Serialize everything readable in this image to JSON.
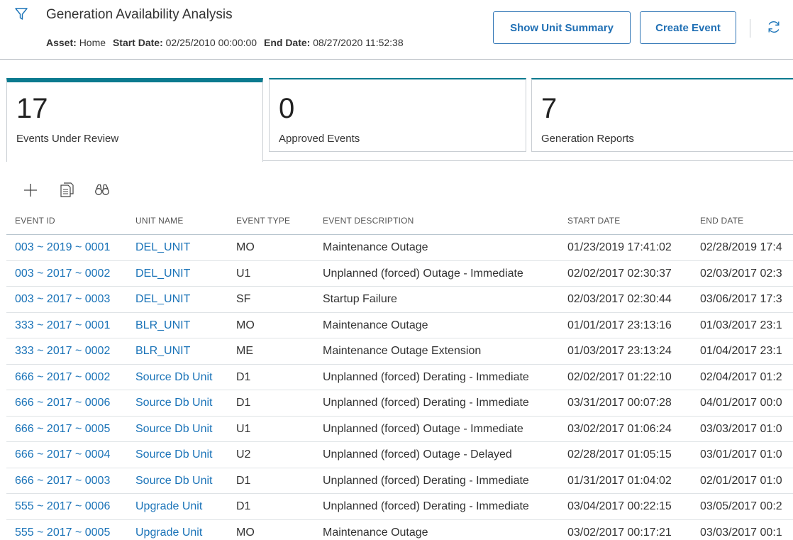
{
  "header": {
    "title": "Generation Availability Analysis",
    "asset_label": "Asset:",
    "asset_value": "Home",
    "start_label": "Start Date:",
    "start_value": "02/25/2010 00:00:00",
    "end_label": "End Date:",
    "end_value": "08/27/2020 11:52:38",
    "show_unit_summary_label": "Show Unit Summary",
    "create_event_label": "Create Event",
    "icons": [
      "filter-icon",
      "refresh-icon"
    ]
  },
  "colors": {
    "accent": "#0b7a8f",
    "link": "#1a73b8",
    "button": "#2e74b5"
  },
  "tiles": [
    {
      "count": "17",
      "label": "Events Under Review",
      "active": true
    },
    {
      "count": "0",
      "label": "Approved Events",
      "active": false
    },
    {
      "count": "7",
      "label": "Generation Reports",
      "active": false
    }
  ],
  "toolbar": {
    "icons": [
      "add-icon",
      "copy-icon",
      "binoculars-icon"
    ]
  },
  "table": {
    "columns": [
      "EVENT ID",
      "UNIT NAME",
      "EVENT TYPE",
      "EVENT DESCRIPTION",
      "START DATE",
      "END DATE"
    ],
    "rows": [
      [
        "003 ~ 2019 ~ 0001",
        "DEL_UNIT",
        "MO",
        "Maintenance Outage",
        "01/23/2019 17:41:02",
        "02/28/2019 17:4"
      ],
      [
        "003 ~ 2017 ~ 0002",
        "DEL_UNIT",
        "U1",
        "Unplanned (forced) Outage - Immediate",
        "02/02/2017 02:30:37",
        "02/03/2017 02:3"
      ],
      [
        "003 ~ 2017 ~ 0003",
        "DEL_UNIT",
        "SF",
        "Startup Failure",
        "02/03/2017 02:30:44",
        "03/06/2017 17:3"
      ],
      [
        "333 ~ 2017 ~ 0001",
        "BLR_UNIT",
        "MO",
        "Maintenance Outage",
        "01/01/2017 23:13:16",
        "01/03/2017 23:1"
      ],
      [
        "333 ~ 2017 ~ 0002",
        "BLR_UNIT",
        "ME",
        "Maintenance Outage Extension",
        "01/03/2017 23:13:24",
        "01/04/2017 23:1"
      ],
      [
        "666 ~ 2017 ~ 0002",
        "Source Db Unit",
        "D1",
        "Unplanned (forced) Derating - Immediate",
        "02/02/2017 01:22:10",
        "02/04/2017 01:2"
      ],
      [
        "666 ~ 2017 ~ 0006",
        "Source Db Unit",
        "D1",
        "Unplanned (forced) Derating - Immediate",
        "03/31/2017 00:07:28",
        "04/01/2017 00:0"
      ],
      [
        "666 ~ 2017 ~ 0005",
        "Source Db Unit",
        "U1",
        "Unplanned (forced) Outage - Immediate",
        "03/02/2017 01:06:24",
        "03/03/2017 01:0"
      ],
      [
        "666 ~ 2017 ~ 0004",
        "Source Db Unit",
        "U2",
        "Unplanned (forced) Outage - Delayed",
        "02/28/2017 01:05:15",
        "03/01/2017 01:0"
      ],
      [
        "666 ~ 2017 ~ 0003",
        "Source Db Unit",
        "D1",
        "Unplanned (forced) Derating - Immediate",
        "01/31/2017 01:04:02",
        "02/01/2017 01:0"
      ],
      [
        "555 ~ 2017 ~ 0006",
        "Upgrade Unit",
        "D1",
        "Unplanned (forced) Derating - Immediate",
        "03/04/2017 00:22:15",
        "03/05/2017 00:2"
      ],
      [
        "555 ~ 2017 ~ 0005",
        "Upgrade Unit",
        "MO",
        "Maintenance Outage",
        "03/02/2017 00:17:21",
        "03/03/2017 00:1"
      ]
    ]
  }
}
